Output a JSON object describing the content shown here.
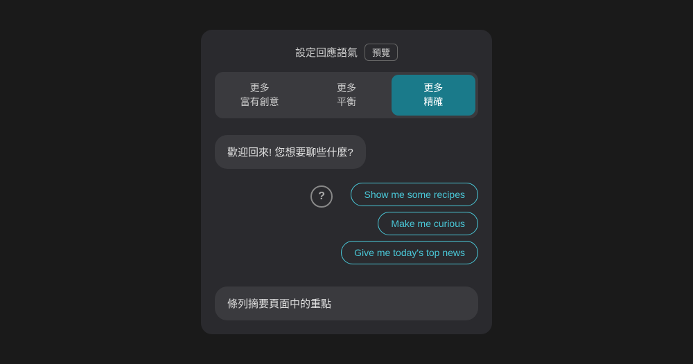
{
  "header": {
    "title": "設定回應語氣",
    "preview_label": "預覽"
  },
  "tone_selector": {
    "options": [
      {
        "id": "creative",
        "label": "更多\n富有創意",
        "active": false
      },
      {
        "id": "balanced",
        "label": "更多\n平衡",
        "active": false
      },
      {
        "id": "precise",
        "label": "更多\n精確",
        "active": true
      }
    ]
  },
  "chat": {
    "welcome_message": "歡迎回來! 您想要聊些什麼?",
    "question_icon_char": "?",
    "suggestions": [
      {
        "label": "Show me some recipes"
      },
      {
        "label": "Make me curious"
      },
      {
        "label": "Give me today's top news"
      }
    ],
    "bottom_bubble": "條列摘要頁面中的重點"
  },
  "colors": {
    "accent": "#4ac8d8",
    "active_bg": "#1a7a8a",
    "bubble_bg": "#3a3a3e",
    "text_primary": "#e0e0e0",
    "text_secondary": "#cccccc"
  }
}
